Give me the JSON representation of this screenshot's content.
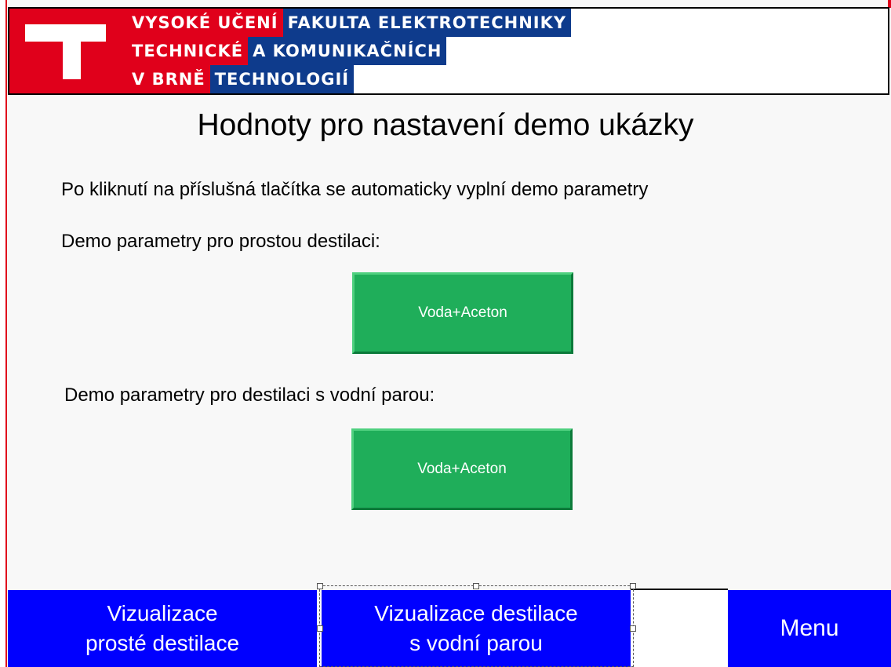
{
  "header": {
    "logo_rows": [
      {
        "red": "VYSOKÉ UČENÍ",
        "blue": "FAKULTA ELEKTROTECHNIKY"
      },
      {
        "red": "TECHNICKÉ",
        "blue": "A KOMUNIKAČNÍCH"
      },
      {
        "red": "V BRNĚ",
        "blue": "TECHNOLOGIÍ"
      }
    ]
  },
  "main": {
    "title": "Hodnoty pro nastavení demo ukázky",
    "instruction": "Po kliknutí na příslušná tlačítka se automaticky vyplní demo parametry",
    "simple_section_label": "Demo parametry pro prostou destilaci:",
    "simple_button_label": "Voda+Aceton",
    "steam_section_label": "Demo parametry pro destilaci s vodní parou:",
    "steam_button_label": "Voda+Aceton"
  },
  "nav": {
    "simple_vis": {
      "line1": "Vizualizace",
      "line2": "prosté destilace"
    },
    "steam_vis": {
      "line1": "Vizualizace destilace",
      "line2": "s vodní parou"
    },
    "menu": "Menu"
  },
  "colors": {
    "brand_red": "#e0001b",
    "brand_blue": "#0e3b8c",
    "nav_blue": "#0000ff",
    "demo_green": "#1fae5a"
  }
}
